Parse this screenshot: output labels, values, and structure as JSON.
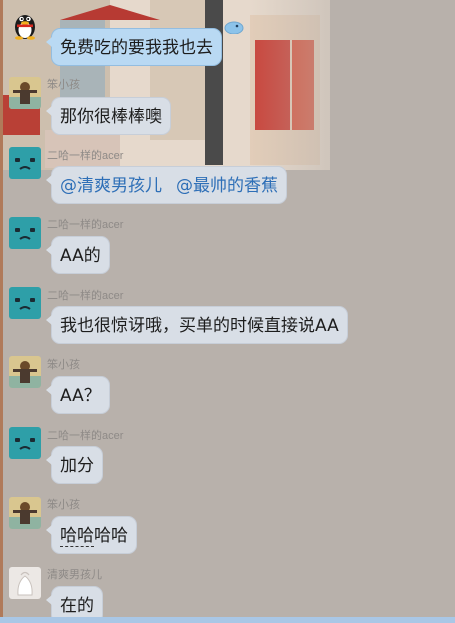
{
  "colors": {
    "background": "#b8b1ab",
    "bubble": "#d8dee6",
    "bubble_highlight": "#b9d9f3",
    "mention": "#2e6fb7",
    "sender_name": "#8e8a87"
  },
  "messages": [
    {
      "sender": "",
      "avatar": "qq-penguin-icon",
      "text": "免费吃的要我我也去",
      "style": "highlight"
    },
    {
      "sender": "笨小孩",
      "avatar": "cartoon-avatar",
      "text": "那你很棒棒噢"
    },
    {
      "sender": "二哈一样的acer",
      "avatar": "teal-face-avatar",
      "mentions": [
        "@清爽男孩儿",
        "@最帅的香蕉"
      ]
    },
    {
      "sender": "二哈一样的acer",
      "avatar": "teal-face-avatar",
      "text": "AA的"
    },
    {
      "sender": "二哈一样的acer",
      "avatar": "teal-face-avatar",
      "text": "我也很惊讶哦，买单的时候直接说AA"
    },
    {
      "sender": "笨小孩",
      "avatar": "cartoon-avatar",
      "text": "AA？"
    },
    {
      "sender": "二哈一样的acer",
      "avatar": "teal-face-avatar",
      "text": "加分"
    },
    {
      "sender": "笨小孩",
      "avatar": "cartoon-avatar",
      "text_underlined": "哈哈",
      "text_rest": "哈哈"
    },
    {
      "sender": "清爽男孩儿",
      "avatar": "white-avatar",
      "text": "在的"
    }
  ]
}
